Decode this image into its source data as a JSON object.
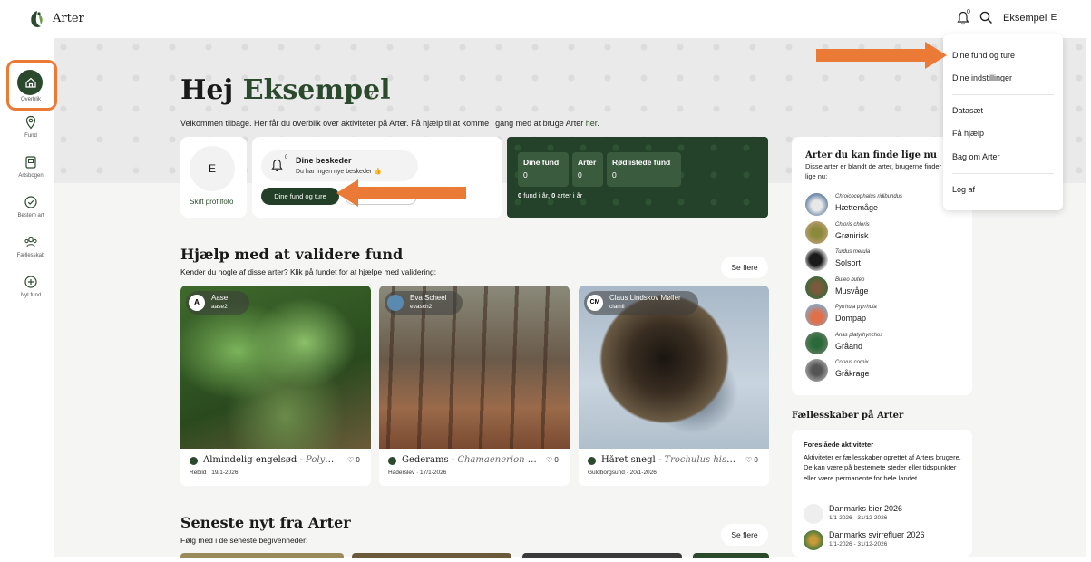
{
  "app": {
    "title": "Arter"
  },
  "header": {
    "notification_count": "0",
    "user_name": "Eksempel",
    "user_initial": "E"
  },
  "sidebar": {
    "items": [
      {
        "label": "Overblik",
        "icon": "home-icon"
      },
      {
        "label": "Fund",
        "icon": "location-pin-icon"
      },
      {
        "label": "Artsbogen",
        "icon": "book-icon"
      },
      {
        "label": "Bestem art",
        "icon": "check-circle-icon"
      },
      {
        "label": "Fællesskab",
        "icon": "community-icon"
      },
      {
        "label": "Nyt fund",
        "icon": "plus-circle-icon"
      }
    ]
  },
  "greeting": {
    "hello": "Hej",
    "name": "Eksempel",
    "help_mark": "?"
  },
  "welcome": {
    "text": "Velkommen tilbage. Her får du overblik over aktiviteter på Arter. Få hjælp til at komme i gang med at bruge Arter",
    "link": "her."
  },
  "profile": {
    "initial": "E",
    "change_photo": "Skift profilfoto"
  },
  "messages": {
    "count": "0",
    "title": "Dine beskeder",
    "subtitle": "Du har ingen nye beskeder 👍",
    "button": "Dine fund og ture"
  },
  "stats": {
    "items": [
      {
        "label": "Dine fund",
        "value": "0"
      },
      {
        "label": "Arter",
        "value": "0"
      },
      {
        "label": "Rødlistede fund",
        "value": "0"
      }
    ],
    "footer_count_fund": "0",
    "footer_mid": " fund i år, ",
    "footer_count_arter": "0",
    "footer_end": " arter i år"
  },
  "dropdown": {
    "items": [
      "Dine fund og ture",
      "Dine indstillinger",
      "Datasæt",
      "Få hjælp",
      "Bag om Arter",
      "Log af"
    ]
  },
  "right_panel": {
    "title": "Arter du kan finde lige nu",
    "subtitle": "Disse arter er blandt de arter, brugerne finder flest af lige nu:",
    "species": [
      {
        "latin": "Chroicocephalus ridibundus",
        "common": "Hættemåge"
      },
      {
        "latin": "Chloris chloris",
        "common": "Grønirisk"
      },
      {
        "latin": "Turdus merula",
        "common": "Solsort"
      },
      {
        "latin": "Buteo buteo",
        "common": "Musvåge"
      },
      {
        "latin": "Pyrrhula pyrrhula",
        "common": "Dompap"
      },
      {
        "latin": "Anas platyrhynchos",
        "common": "Gråand"
      },
      {
        "latin": "Corvus cornix",
        "common": "Gråkrage"
      }
    ]
  },
  "community": {
    "title": "Fællesskaber på Arter",
    "card_head": "Foreslåede aktiviteter",
    "card_text": "Aktiviteter er fællesskaber oprettet af Arters brugere. De kan være på bestemete steder eller tidspunkter eller være permanente for hele landet.",
    "events": [
      {
        "name": "Danmarks bier 2026",
        "date": "1/1-2026 - 31/12-2026"
      },
      {
        "name": "Danmarks svirrefluer 2026",
        "date": "1/1-2026 - 31/12-2026"
      }
    ]
  },
  "validate": {
    "title": "Hjælp med at validere fund",
    "subtitle": "Kender du nogle af disse arter? Klik på fundet for at hjælpe med validering:",
    "see_more": "Se flere",
    "finds": [
      {
        "user_initial": "A",
        "user": "Aase",
        "handle": "aase2",
        "name": "Almindelig engelsød",
        "latin": "- Polypo...",
        "likes": "0",
        "place": "Rebild",
        "date": "19/1-2026"
      },
      {
        "user_initial": "",
        "user": "Eva Scheel",
        "handle": "evasch2",
        "name": "Gederams",
        "latin": "- Chamaenerion a...",
        "likes": "0",
        "place": "Haderslev",
        "date": "17/1-2026"
      },
      {
        "user_initial": "CM",
        "user": "Claus Lindskov Møller",
        "handle": "clamil",
        "name": "Håret snegl",
        "latin": "- Trochulus hispi...",
        "likes": "0",
        "place": "Guldborgsund",
        "date": "20/1-2026"
      }
    ]
  },
  "news": {
    "title": "Seneste nyt fra Arter",
    "subtitle": "Følg med i de seneste begivenheder:",
    "see_more": "Se flere"
  },
  "colors": {
    "brand_green": "#2b4a2d",
    "highlight_orange": "#ea7a35"
  }
}
